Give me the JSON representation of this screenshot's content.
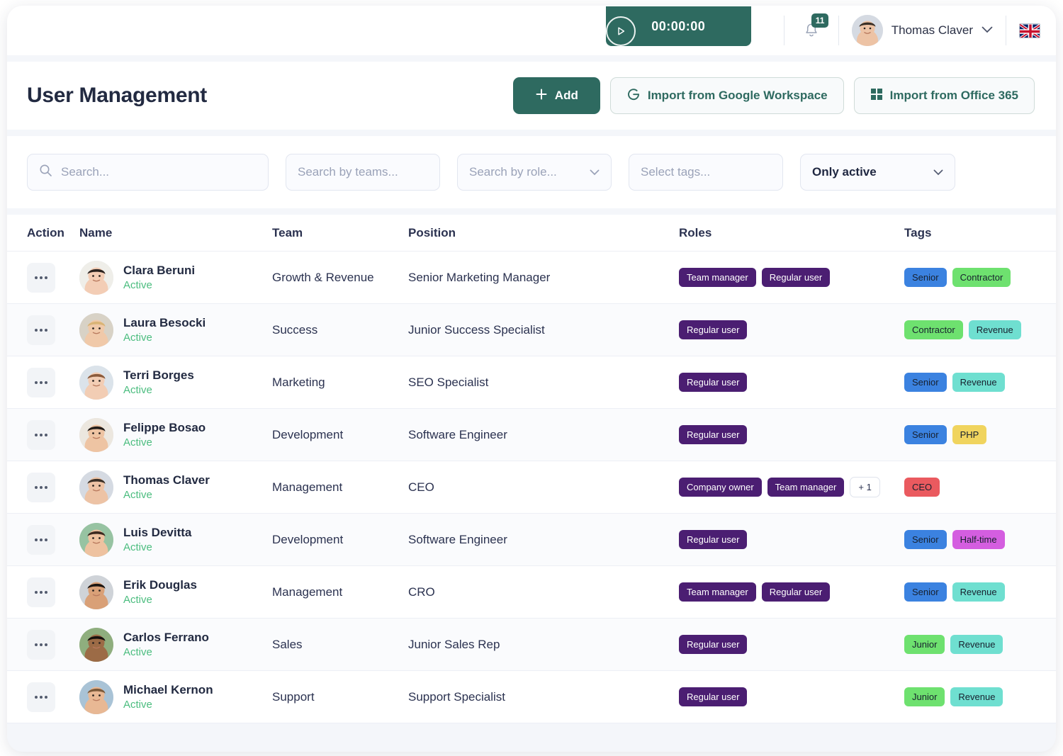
{
  "topbar": {
    "timer": {
      "value": "00:00:00",
      "play_icon": "play-icon"
    },
    "notifications": {
      "count": "11",
      "icon": "bell-icon"
    },
    "user": {
      "name": "Thomas Claver",
      "chevron": "chevron-down-icon"
    },
    "language": {
      "flag": "uk-flag-icon"
    }
  },
  "header": {
    "title": "User Management",
    "add_label": "Add",
    "import_google_label": "Import from Google Workspace",
    "import_office_label": "Import from Office 365"
  },
  "filters": {
    "search_placeholder": "Search...",
    "teams_placeholder": "Search by teams...",
    "role_placeholder": "Search by role...",
    "tags_placeholder": "Select tags...",
    "status_value": "Only active"
  },
  "table": {
    "columns": [
      "Action",
      "Name",
      "Team",
      "Position",
      "Roles",
      "Tags"
    ],
    "rows": [
      {
        "name": "Clara Beruni",
        "status": "Active",
        "team": "Growth & Revenue",
        "position": "Senior Marketing Manager",
        "roles": [
          "Team manager",
          "Regular user"
        ],
        "roles_more": "",
        "tags": [
          {
            "label": "Senior",
            "color": "#3b82e0"
          },
          {
            "label": "Contractor",
            "color": "#6ee16f"
          }
        ],
        "avatar": {
          "skin": "#f3cdb5",
          "hair": "#2b2320",
          "bg": "#efeee9"
        }
      },
      {
        "name": "Laura Besocki",
        "status": "Active",
        "team": "Success",
        "position": "Junior Success Specialist",
        "roles": [
          "Regular user"
        ],
        "roles_more": "",
        "tags": [
          {
            "label": "Contractor",
            "color": "#6ee16f"
          },
          {
            "label": "Revenue",
            "color": "#6fdfd0"
          }
        ],
        "avatar": {
          "skin": "#f0c9a9",
          "hair": "#d9b476",
          "bg": "#d8d2c6"
        }
      },
      {
        "name": "Terri Borges",
        "status": "Active",
        "team": "Marketing",
        "position": "SEO Specialist",
        "roles": [
          "Regular user"
        ],
        "roles_more": "",
        "tags": [
          {
            "label": "Senior",
            "color": "#3b82e0"
          },
          {
            "label": "Revenue",
            "color": "#6fdfd0"
          }
        ],
        "avatar": {
          "skin": "#f2cdb4",
          "hair": "#8a5a3b",
          "bg": "#dbe3ea"
        }
      },
      {
        "name": "Felippe Bosao",
        "status": "Active",
        "team": "Development",
        "position": "Software Engineer",
        "roles": [
          "Regular user"
        ],
        "roles_more": "",
        "tags": [
          {
            "label": "Senior",
            "color": "#3b82e0"
          },
          {
            "label": "PHP",
            "color": "#f0d45e"
          }
        ],
        "avatar": {
          "skin": "#eec4a3",
          "hair": "#221c18",
          "bg": "#ece7df"
        }
      },
      {
        "name": "Thomas Claver",
        "status": "Active",
        "team": "Management",
        "position": "CEO",
        "roles": [
          "Company owner",
          "Team manager"
        ],
        "roles_more": "+ 1",
        "tags": [
          {
            "label": "CEO",
            "color": "#ea5a5f"
          }
        ],
        "avatar": {
          "skin": "#edc3a5",
          "hair": "#3a3027",
          "bg": "#d5dae2"
        }
      },
      {
        "name": "Luis Devitta",
        "status": "Active",
        "team": "Development",
        "position": "Software Engineer",
        "roles": [
          "Regular user"
        ],
        "roles_more": "",
        "tags": [
          {
            "label": "Senior",
            "color": "#3b82e0"
          },
          {
            "label": "Half-time",
            "color": "#d45ee0"
          }
        ],
        "avatar": {
          "skin": "#eec2a0",
          "hair": "#3c2a20",
          "bg": "#97c3a2"
        }
      },
      {
        "name": "Erik Douglas",
        "status": "Active",
        "team": "Management",
        "position": "CRO",
        "roles": [
          "Team manager",
          "Regular user"
        ],
        "roles_more": "",
        "tags": [
          {
            "label": "Senior",
            "color": "#3b82e0"
          },
          {
            "label": "Revenue",
            "color": "#6fdfd0"
          }
        ],
        "avatar": {
          "skin": "#d9a077",
          "hair": "#1b1512",
          "bg": "#cfd3d8"
        }
      },
      {
        "name": "Carlos Ferrano",
        "status": "Active",
        "team": "Sales",
        "position": "Junior Sales Rep",
        "roles": [
          "Regular user"
        ],
        "roles_more": "",
        "tags": [
          {
            "label": "Junior",
            "color": "#6ee16f"
          },
          {
            "label": "Revenue",
            "color": "#6fdfd0"
          }
        ],
        "avatar": {
          "skin": "#9c6b46",
          "hair": "#16100d",
          "bg": "#8fae7e"
        }
      },
      {
        "name": "Michael Kernon",
        "status": "Active",
        "team": "Support",
        "position": "Support Specialist",
        "roles": [
          "Regular user"
        ],
        "roles_more": "",
        "tags": [
          {
            "label": "Junior",
            "color": "#6ee16f"
          },
          {
            "label": "Revenue",
            "color": "#6fdfd0"
          }
        ],
        "avatar": {
          "skin": "#e8b894",
          "hair": "#7c5a3a",
          "bg": "#a9c3d6"
        }
      }
    ]
  },
  "colors": {
    "brand_green": "#2e6a60",
    "role_purple": "#4b1e72",
    "active_green": "#4bbd7f",
    "title_ink": "#222a41"
  }
}
